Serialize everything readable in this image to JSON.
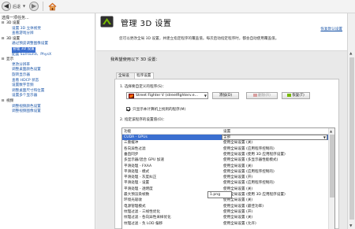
{
  "toolbar": {
    "back_label": "后退",
    "back_icon": "back-arrow-icon",
    "forward_icon": "forward-arrow-icon",
    "home_icon": "home-icon"
  },
  "left": {
    "header": "选择一项任务...",
    "tree": [
      {
        "kind": "cat",
        "level": 0,
        "expander": "⊟",
        "label": "3D 设置"
      },
      {
        "kind": "sub",
        "level": 1,
        "label": "设置 3D 立体视觉"
      },
      {
        "kind": "sub",
        "level": 1,
        "label": "查看游戏分辨"
      },
      {
        "kind": "cat",
        "level": 0,
        "expander": "⊟",
        "label": "3D 设置"
      },
      {
        "kind": "sub",
        "level": 1,
        "label": "通过预览调整图像设置"
      },
      {
        "kind": "sub",
        "level": 1,
        "label": "管理 3D 设置",
        "selected": true
      },
      {
        "kind": "sub",
        "level": 1,
        "label": "配置 Surround、PhysX"
      },
      {
        "kind": "cat",
        "level": 0,
        "expander": "⊟",
        "label": "显示"
      },
      {
        "kind": "sub",
        "level": 1,
        "label": "更改分辨率"
      },
      {
        "kind": "sub",
        "level": 1,
        "label": "调整桌面颜色设置"
      },
      {
        "kind": "sub",
        "level": 1,
        "label": "旋转显示器"
      },
      {
        "kind": "sub",
        "level": 1,
        "label": "查看 HDCP 状态"
      },
      {
        "kind": "sub",
        "level": 1,
        "label": "设置数字音频"
      },
      {
        "kind": "sub",
        "level": 1,
        "label": "调整桌面尺寸和位置"
      },
      {
        "kind": "sub",
        "level": 1,
        "label": "设置多个显示器"
      },
      {
        "kind": "cat",
        "level": 0,
        "expander": "⊟",
        "label": "视频"
      },
      {
        "kind": "sub",
        "level": 1,
        "label": "调整视频颜色设置"
      },
      {
        "kind": "sub",
        "level": 1,
        "label": "调整视频图像设置"
      }
    ]
  },
  "banner": {
    "title": "管理 3D 设置",
    "restore_link": "恢复默认设置",
    "description": "您可以更改全局 3D 设置，并建立指定程序的覆盖值。每次启动指定程序时，都会自动使用覆盖值。"
  },
  "main": {
    "section_head": "我希望使用以下 3D 设置：",
    "tabs": [
      {
        "label": "全局设置",
        "active": false
      },
      {
        "label": "程序设置",
        "active": true
      }
    ],
    "step1_label": "1. 选择要自定义的程序(S)：",
    "program_value": "Street Fighter V (streetfighterv.e...",
    "add_button": "添加(D)",
    "delete_button": "删除(R)",
    "restore_button": "恢复(T)",
    "checkbox_label": "只显示本计算机上找到的程序(M)",
    "step2_label": "2. 指定该程序的设置值(O)：",
    "col_feature": "功能",
    "col_setting": "设置",
    "rows": [
      {
        "feature": "CUDA - GPUs",
        "setting": "全部",
        "selected": true
      },
      {
        "feature": "三重缓冲",
        "setting": "使用全局设置 (关)"
      },
      {
        "feature": "各向异性过滤",
        "setting": "使用全局设置 (应用程序控制的)"
      },
      {
        "feature": "垂直同步",
        "setting": "使用全局设置 (使用 3D 应用程序设置)"
      },
      {
        "feature": "多显示器/混合 GPU 加速",
        "setting": "使用全局设置 (多显示器性能模式)"
      },
      {
        "feature": "平滑处理 - FXAA",
        "setting": "使用全局设置 (关)"
      },
      {
        "feature": "平滑处理 - 模式",
        "setting": "使用全局设置 (应用程序控制的)"
      },
      {
        "feature": "平滑处理 - 灰度纠正",
        "setting": "使用全局设置 (开)"
      },
      {
        "feature": "平滑处理 - 设置",
        "setting": "使用全局设置 (应用程序控制的)"
      },
      {
        "feature": "平滑处理 - 透明度",
        "setting": "使用全局设置 (关)"
      },
      {
        "feature": "最大预渲染帧数",
        "setting": "使用全局设置 (使用 3D 应用程序设置)"
      },
      {
        "feature": "环境光吸收",
        "setting": "使用全局设置 (关)"
      },
      {
        "feature": "电源管理模式",
        "setting": "使用全局设置 (最佳功率)"
      },
      {
        "feature": "纹理过滤 - 三线性优化",
        "setting": "使用全局设置 (开)"
      },
      {
        "feature": "纹理过滤 - 各向异性采样优化",
        "setting": "使用全局设置 (关)"
      },
      {
        "feature": "纹理过滤 - 负 LOD 偏移",
        "setting": "使用全局设置 (允许)"
      }
    ],
    "tooltip": "1.png"
  },
  "colors": {
    "selection": "#3b6fd0",
    "link": "#1a55a8",
    "nvidia_green": "#76b900"
  }
}
